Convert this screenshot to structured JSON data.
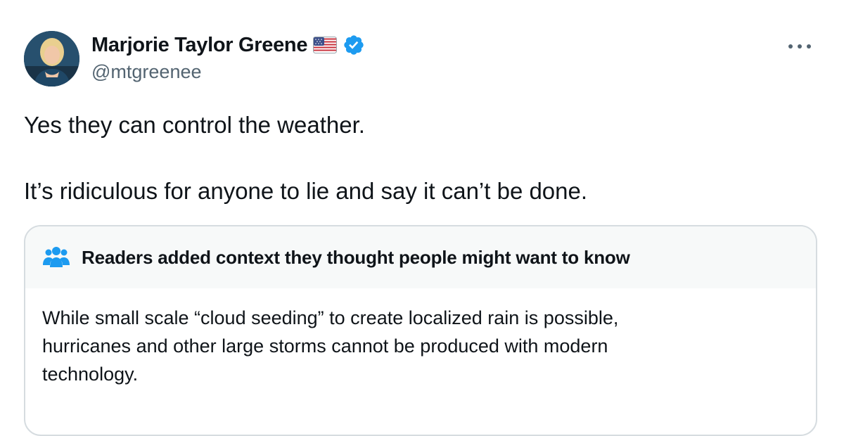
{
  "author": {
    "name": "Marjorie Taylor Greene",
    "handle": "@mtgreenee",
    "flag_icon": "us-flag-icon",
    "verified_icon": "verified-badge-icon",
    "verified_color": "#1d9bf0"
  },
  "more_icon": "more-options-icon",
  "tweet": {
    "line1": "Yes they can control the weather.",
    "line2": "It’s ridiculous for anyone to lie and say it can’t be done."
  },
  "community_note": {
    "icon": "people-icon",
    "icon_color": "#1d9bf0",
    "title": "Readers added context they thought people might want to know",
    "lines": [
      "While small scale “cloud seeding” to create localized rain is possible,",
      "hurricanes and other large storms cannot be produced with modern",
      "technology."
    ]
  }
}
